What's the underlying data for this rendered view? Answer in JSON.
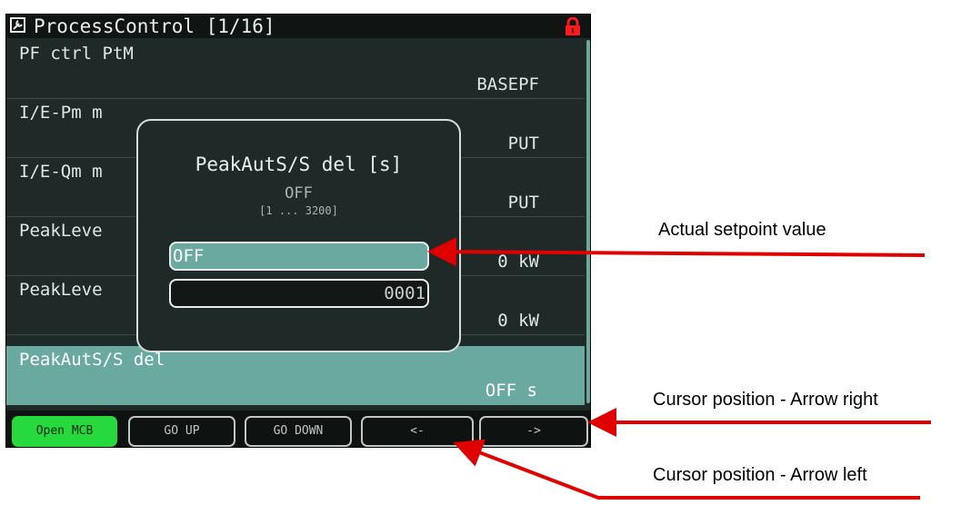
{
  "window": {
    "title": "ProcessControl [1/16]",
    "icon": "wrench-icon",
    "lock_icon": "lock-icon",
    "lock_color": "#ff1a1a"
  },
  "rows": [
    {
      "name": "PF ctrl PtM",
      "value": "BASEPF"
    },
    {
      "name": "I/E-Pm m",
      "value": "PUT"
    },
    {
      "name": "I/E-Qm m",
      "value": "PUT"
    },
    {
      "name": "PeakLeve",
      "value": "0 kW"
    },
    {
      "name": "PeakLeve",
      "value": "0 kW"
    },
    {
      "name": "PeakAutS/S del",
      "value": "OFF s",
      "selected": true
    }
  ],
  "dialog": {
    "title": "PeakAutS/S del [s]",
    "current_value": "OFF",
    "range": "[1 ... 3200]",
    "actual_field": "OFF",
    "edit_field": "0001"
  },
  "softkeys": [
    {
      "label": "Open MCB"
    },
    {
      "label": "GO UP"
    },
    {
      "label": "GO DOWN"
    },
    {
      "label": "<-"
    },
    {
      "label": "->"
    }
  ],
  "annotations": {
    "actual_setpoint": "Actual setpoint value",
    "cursor_right": "Cursor position - Arrow right",
    "cursor_left": "Cursor position - Arrow left"
  },
  "colors": {
    "accent": "#6aa9a0",
    "screen_bg": "#1f2a28",
    "softkey_active": "#26d93d",
    "arrow": "#e00000"
  }
}
